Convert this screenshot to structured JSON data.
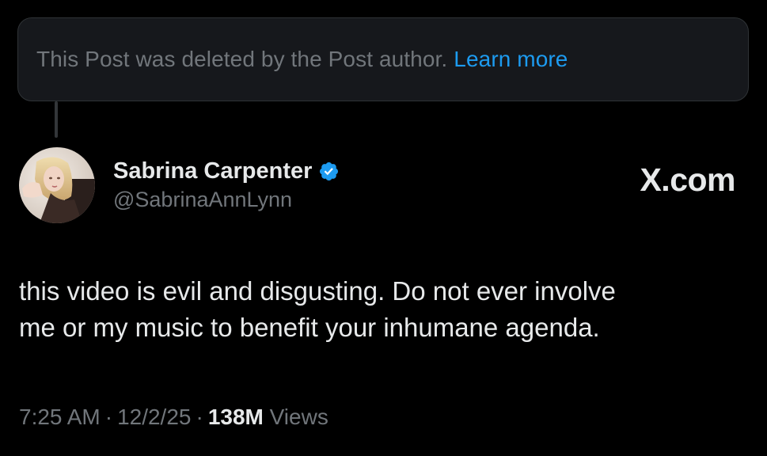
{
  "notice": {
    "text": "This Post was deleted by the Post author.",
    "link": "Learn more"
  },
  "author": {
    "name": "Sabrina Carpenter",
    "handle": "@SabrinaAnnLynn",
    "verified_icon": "verified-badge-icon"
  },
  "brand": "X.com",
  "post": {
    "lines": [
      "this video is evil and disgusting. Do not ever involve",
      "me or my music to benefit your inhumane agenda."
    ]
  },
  "meta": {
    "time": "7:25 AM",
    "separator": "·",
    "date": "12/2/25",
    "views_count": "138M",
    "views_label": "Views"
  },
  "colors": {
    "background": "#000000",
    "link": "#1d9bf0",
    "muted": "#71767b",
    "text": "#e7e9ea",
    "notice_bg": "#16181c"
  }
}
